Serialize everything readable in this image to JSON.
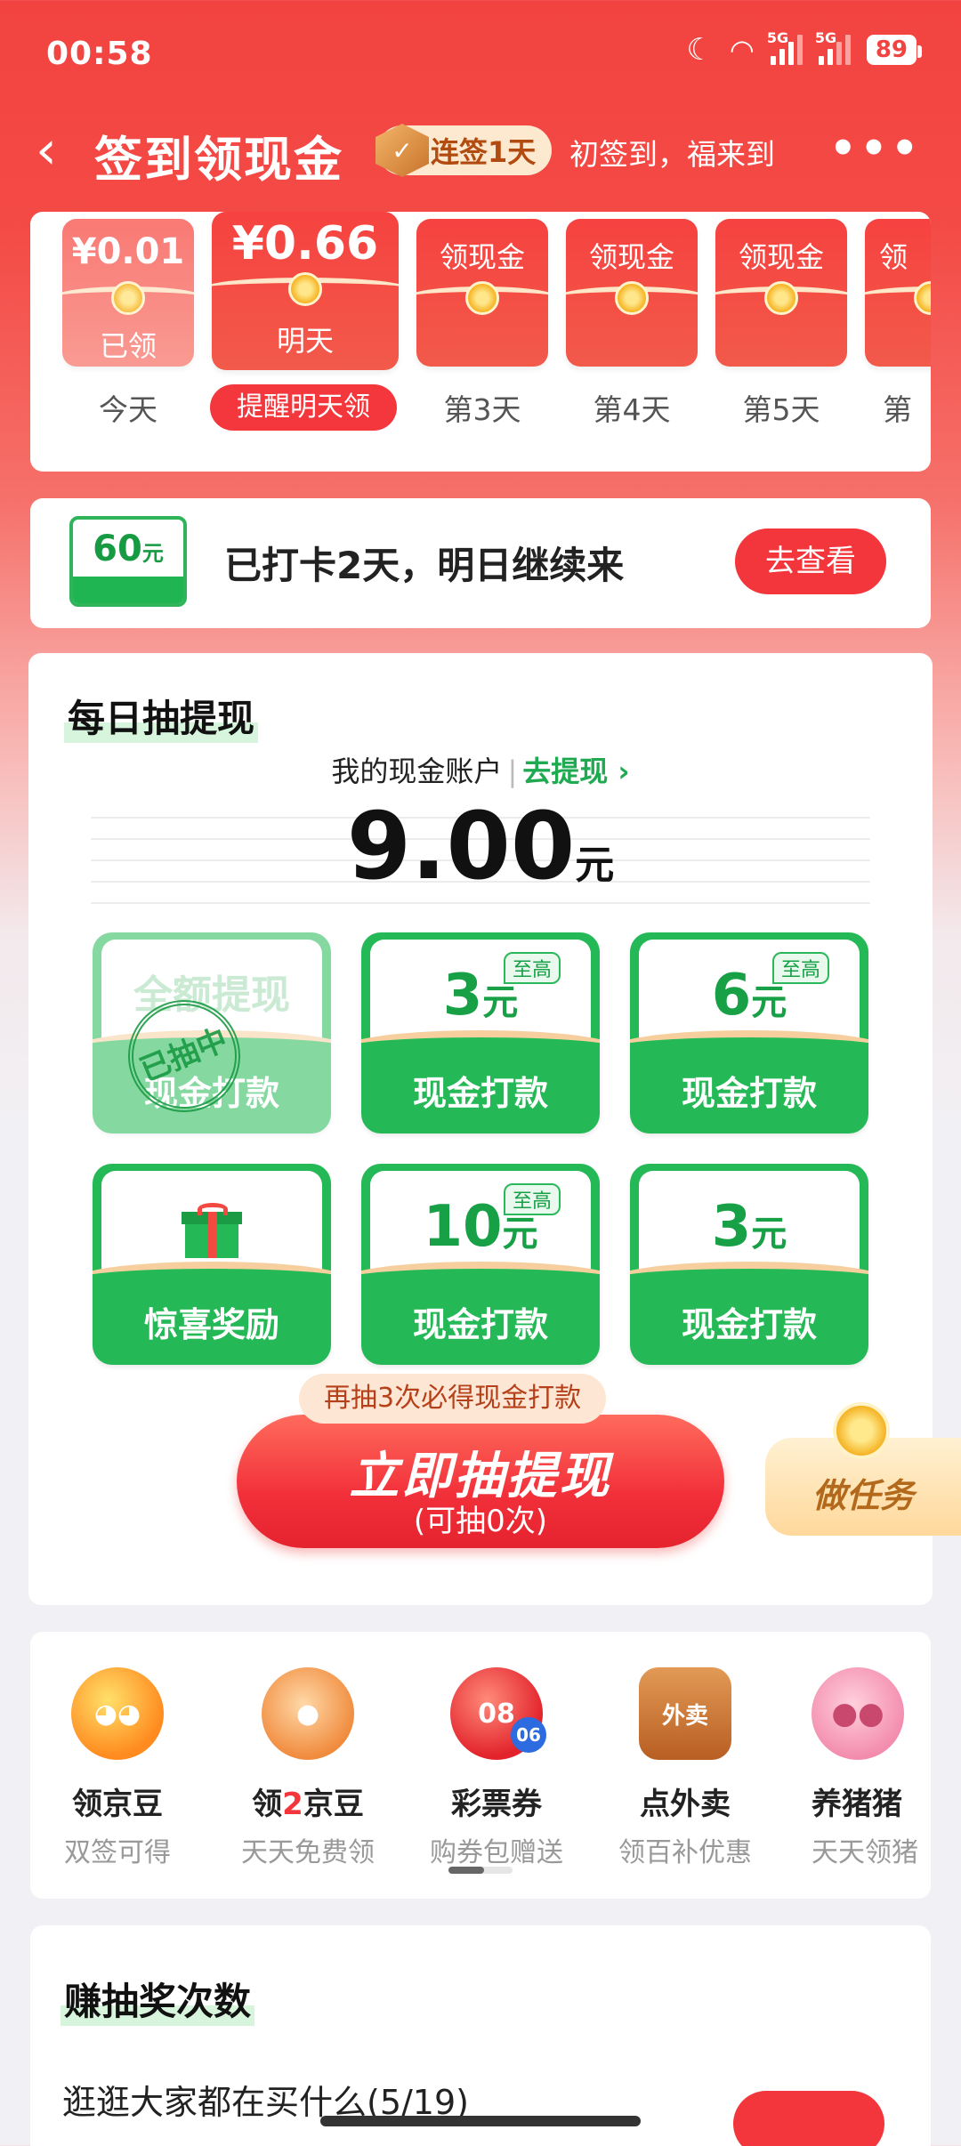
{
  "status_bar": {
    "time": "00:58",
    "signal1": "5G",
    "signal2": "5G",
    "battery": "89"
  },
  "header": {
    "back_glyph": "‹",
    "title": "签到领现金",
    "badge": "连签1天",
    "subtitle": "初签到，福来到",
    "more_glyph": "•••"
  },
  "days": [
    {
      "amount": "¥0.01",
      "state": "已领",
      "label": "今天"
    },
    {
      "amount": "¥0.66",
      "state": "明天",
      "label": "提醒明天领"
    },
    {
      "top": "领现金",
      "label": "第3天"
    },
    {
      "top": "领现金",
      "label": "第4天"
    },
    {
      "top": "领现金",
      "label": "第5天"
    },
    {
      "top": "领",
      "label": "第"
    }
  ],
  "checkin": {
    "ticket_value": "60",
    "ticket_unit": "元",
    "text": "已打卡2天，明日继续来",
    "button": "去查看"
  },
  "draw": {
    "title": "每日抽提现",
    "account_label": "我的现金账户",
    "withdraw_link": "去提现",
    "balance": "9.00",
    "balance_unit": "元",
    "tiles": [
      {
        "ghost": "全额提现",
        "stamp": "已抽中",
        "label": "现金打款"
      },
      {
        "value": "3",
        "unit": "元",
        "tag": "至高",
        "label": "现金打款"
      },
      {
        "value": "6",
        "unit": "元",
        "tag": "至高",
        "label": "现金打款"
      },
      {
        "label": "惊喜奖励"
      },
      {
        "value": "10",
        "unit": "元",
        "tag": "至高",
        "label": "现金打款"
      },
      {
        "value": "3",
        "unit": "元",
        "label": "现金打款"
      }
    ],
    "hint": "再抽3次必得现金打款",
    "button": "立即抽提现",
    "button_sub": "(可抽0次)",
    "task": "做任务"
  },
  "shortcuts": [
    {
      "name": "领京豆",
      "desc": "双签可得"
    },
    {
      "name_pre": "领",
      "name_num": "2",
      "name_post": "京豆",
      "desc": "天天免费领"
    },
    {
      "name": "彩票券",
      "desc": "购券包赠送",
      "icon_text": "08",
      "icon_sub": "06"
    },
    {
      "name": "点外卖",
      "desc": "领百补优惠",
      "icon_text": "外卖"
    },
    {
      "name": "养猪猪",
      "desc": "天天领猪"
    }
  ],
  "earn": {
    "title": "赚抽奖次数",
    "row": "逛逛大家都在买什么(5/19)"
  },
  "colors": {
    "primary_red": "#f24340",
    "green": "#24b956",
    "gold": "#f5b321"
  }
}
